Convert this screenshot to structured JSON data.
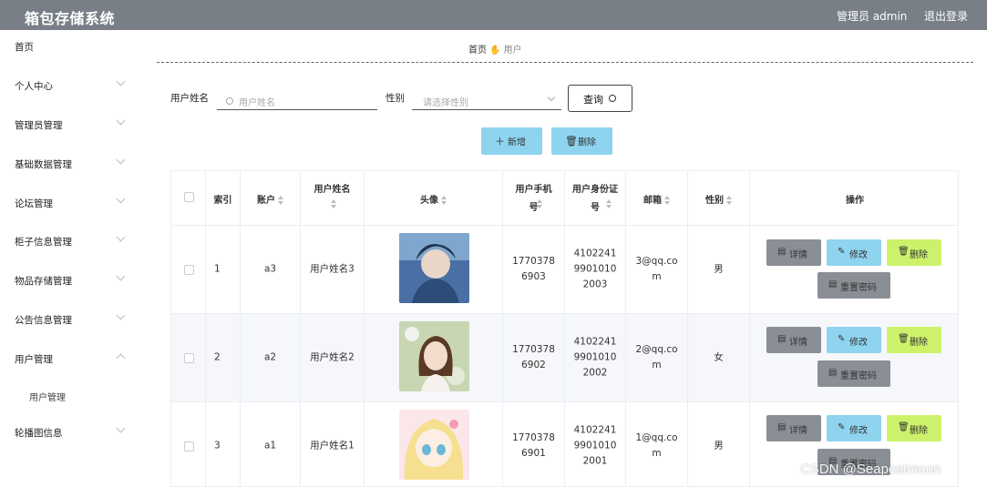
{
  "header": {
    "title": "箱包存储系统",
    "admin": "管理员 admin",
    "logout": "退出登录"
  },
  "sidebar": {
    "items": [
      {
        "label": "首页"
      },
      {
        "label": "个人中心"
      },
      {
        "label": "管理员管理"
      },
      {
        "label": "基础数据管理"
      },
      {
        "label": "论坛管理"
      },
      {
        "label": "柜子信息管理"
      },
      {
        "label": "物品存储管理"
      },
      {
        "label": "公告信息管理"
      },
      {
        "label": "用户管理"
      },
      {
        "label": "用户管理"
      },
      {
        "label": "轮播图信息"
      }
    ]
  },
  "breadcrumb": {
    "home": "首页",
    "current": "用户"
  },
  "search": {
    "name_label": "用户姓名",
    "name_placeholder": "用户姓名",
    "gender_label": "性别",
    "gender_placeholder": "请选择性别",
    "query_label": "查询"
  },
  "actions": {
    "add": "新增",
    "delete": "删除"
  },
  "table": {
    "headers": [
      "索引",
      "账户",
      "用户姓名",
      "头像",
      "用户手机号",
      "用户身份证号",
      "邮箱",
      "性别",
      "操作"
    ],
    "rows": [
      {
        "index": "1",
        "account": "a3",
        "name": "用户姓名3",
        "phone": "17703786903",
        "idcard": "410224199010102003",
        "email": "3@qq.com",
        "gender": "男"
      },
      {
        "index": "2",
        "account": "a2",
        "name": "用户姓名2",
        "phone": "17703786902",
        "idcard": "410224199010102002",
        "email": "2@qq.com",
        "gender": "女"
      },
      {
        "index": "3",
        "account": "a1",
        "name": "用户姓名1",
        "phone": "17703786901",
        "idcard": "410224199010102001",
        "email": "1@qq.com",
        "gender": "男"
      }
    ],
    "row_actions": {
      "detail": "详情",
      "edit": "修改",
      "delete": "删除",
      "reset": "重置密码"
    }
  },
  "watermark": "CSDN @Seapostmoon",
  "colors": {
    "header_bg": "#787f87",
    "btn_blue": "#8ed4ef",
    "btn_green": "#ccf26b",
    "btn_gray": "#8a8f96"
  }
}
